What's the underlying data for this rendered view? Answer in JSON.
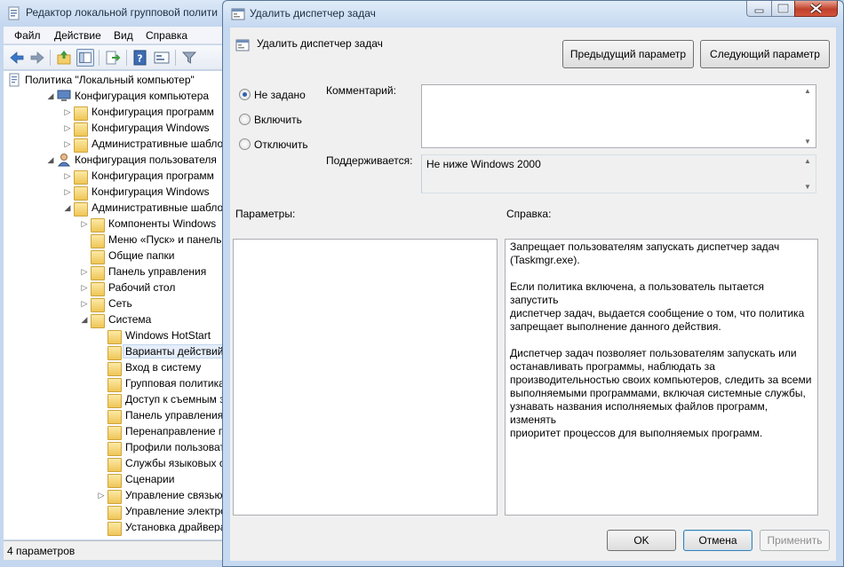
{
  "gpe": {
    "title": "Редактор локальной групповой полити",
    "menu": [
      "Файл",
      "Действие",
      "Вид",
      "Справка"
    ],
    "toolbar_icons": [
      "back-arrow-icon",
      "forward-arrow-icon",
      "up-folder-icon",
      "show-hide-tree-icon",
      "export-list-icon",
      "help-icon",
      "properties-icon",
      "filter-icon"
    ],
    "tree": [
      {
        "label": "Политика \"Локальный компьютер\"",
        "icon": "policy-doc-icon",
        "exp": ""
      },
      {
        "label": "Конфигурация компьютера",
        "icon": "computer-icon",
        "exp": "◢"
      },
      {
        "label": "Конфигурация программ",
        "icon": "folder-icon",
        "exp": "▷"
      },
      {
        "label": "Конфигурация Windows",
        "icon": "folder-icon",
        "exp": "▷"
      },
      {
        "label": "Административные шаблоны",
        "icon": "folder-icon",
        "exp": "▷"
      },
      {
        "label": "Конфигурация пользователя",
        "icon": "user-icon",
        "exp": "◢"
      },
      {
        "label": "Конфигурация программ",
        "icon": "folder-icon",
        "exp": "▷"
      },
      {
        "label": "Конфигурация Windows",
        "icon": "folder-icon",
        "exp": "▷"
      },
      {
        "label": "Административные шаблоны",
        "icon": "folder-icon",
        "exp": "◢"
      },
      {
        "label": "Компоненты Windows",
        "icon": "folder-icon",
        "exp": "▷"
      },
      {
        "label": "Меню «Пуск» и панель задач",
        "icon": "folder-icon",
        "exp": ""
      },
      {
        "label": "Общие папки",
        "icon": "folder-icon",
        "exp": ""
      },
      {
        "label": "Панель управления",
        "icon": "folder-icon",
        "exp": "▷"
      },
      {
        "label": "Рабочий стол",
        "icon": "folder-icon",
        "exp": "▷"
      },
      {
        "label": "Сеть",
        "icon": "folder-icon",
        "exp": "▷"
      },
      {
        "label": "Система",
        "icon": "folder-icon",
        "exp": "◢"
      },
      {
        "label": "Windows HotStart",
        "icon": "folder-icon",
        "exp": ""
      },
      {
        "label": "Варианты действий после нажатия CTRL+ALT+DEL",
        "icon": "folder-icon",
        "exp": ""
      },
      {
        "label": "Вход в систему",
        "icon": "folder-icon",
        "exp": ""
      },
      {
        "label": "Групповая политика",
        "icon": "folder-icon",
        "exp": ""
      },
      {
        "label": "Доступ к съемным запоминающим устройствам",
        "icon": "folder-icon",
        "exp": ""
      },
      {
        "label": "Панель управления производительностью",
        "icon": "folder-icon",
        "exp": ""
      },
      {
        "label": "Перенаправление папки",
        "icon": "folder-icon",
        "exp": ""
      },
      {
        "label": "Профили пользователей",
        "icon": "folder-icon",
        "exp": ""
      },
      {
        "label": "Службы языковых стандартов",
        "icon": "folder-icon",
        "exp": ""
      },
      {
        "label": "Сценарии",
        "icon": "folder-icon",
        "exp": ""
      },
      {
        "label": "Управление связью через Интернет",
        "icon": "folder-icon",
        "exp": "▷"
      },
      {
        "label": "Управление электропитанием",
        "icon": "folder-icon",
        "exp": ""
      },
      {
        "label": "Установка драйвера",
        "icon": "folder-icon",
        "exp": ""
      }
    ],
    "selected_index": 17,
    "status": "4 параметров"
  },
  "dialog": {
    "title": "Удалить диспетчер задач",
    "policy_name": "Удалить диспетчер задач",
    "buttons": {
      "prev": "Предыдущий параметр",
      "next": "Следующий параметр",
      "ok": "OK",
      "cancel": "Отмена",
      "apply": "Применить"
    },
    "state_options": [
      "Не задано",
      "Включить",
      "Отключить"
    ],
    "selected_state": "Не задано",
    "comment_label": "Комментарий:",
    "comment_value": "",
    "supported_label": "Поддерживается:",
    "supported_value": "Не ниже Windows 2000",
    "options_label": "Параметры:",
    "help_label": "Справка:",
    "help_text": "Запрещает пользователям запускать диспетчер задач\n(Taskmgr.exe).\n\nЕсли политика включена, а пользователь пытается запустить\nдиспетчер задач, выдается сообщение о том, что политика\nзапрещает выполнение данного действия.\n\nДиспетчер задач позволяет пользователям запускать или\nостанавливать программы, наблюдать за\nпроизводительностью своих компьютеров, следить за всеми\nвыполняемыми программами, включая системные службы,\nузнавать названия исполняемых файлов программ, изменять\nприоритет процессов для выполняемых программ."
  },
  "colors": {
    "window_frame": "#c5d9f1",
    "dialog_face": "#f0f0f0",
    "close_button": "#c0412b",
    "default_button_border": "#3c7fb1"
  }
}
